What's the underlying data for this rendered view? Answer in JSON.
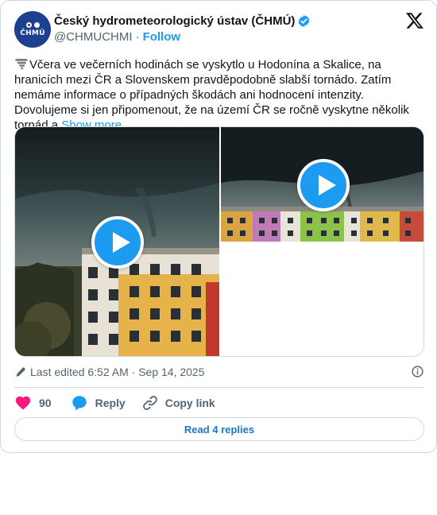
{
  "author": {
    "display_name": "Český hydrometeorologický ústav (ČHMÚ)",
    "handle": "@CHMUCHMI",
    "separator": "·",
    "follow_label": "Follow",
    "avatar_text": "ČHMÚ",
    "verified": true
  },
  "tweet": {
    "emoji_icon": "tornado-icon",
    "text": "Včera ve večerních hodinách se vyskytlo u Hodonína a Skalice, na hranicích mezi ČR a Slovenskem pravděpodobně slabší tornádo. Zatím nemáme informace o případných škodách ani hodnocení intenzity.  Dovolujeme si jen připomenout, že na území ČR se ročně vyskytne několik tornád a",
    "show_more_label": "Show more"
  },
  "media": {
    "items": [
      {
        "type": "video",
        "scene": "storm-cloud-over-apartment-block"
      },
      {
        "type": "video",
        "scene": "funnel-cloud-over-colorful-panel-houses"
      }
    ]
  },
  "meta": {
    "edited_text": "Last edited 6:52 AM · Sep 14, 2025"
  },
  "actions": {
    "like_count": "90",
    "reply_label": "Reply",
    "copy_label": "Copy link",
    "read_replies_label": "Read 4 replies"
  },
  "colors": {
    "accent": "#1d9bf0",
    "like": "#f91880",
    "border": "#cfd9de",
    "secondary_text": "#536471"
  }
}
